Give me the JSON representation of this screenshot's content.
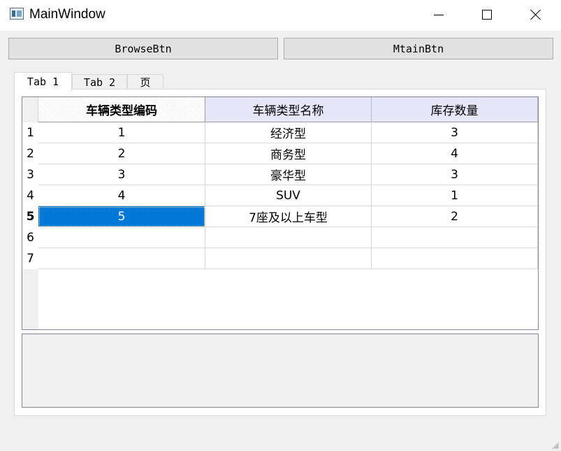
{
  "window": {
    "title": "MainWindow",
    "icon": "app-window-icon",
    "controls": [
      "minimize-icon",
      "maximize-icon",
      "close-icon"
    ]
  },
  "toolbar": {
    "browse_label": "BrowseBtn",
    "mtain_label": "MtainBtn"
  },
  "tabs": [
    {
      "label": "Tab 1",
      "active": true
    },
    {
      "label": "Tab 2",
      "active": false
    },
    {
      "label": "页",
      "active": false
    }
  ],
  "table": {
    "columns": [
      "车辆类型编码",
      "车辆类型名称",
      "库存数量"
    ],
    "row_headers": [
      "1",
      "2",
      "3",
      "4",
      "5",
      "6",
      "7"
    ],
    "rows": [
      [
        "1",
        "经济型",
        "3"
      ],
      [
        "2",
        "商务型",
        "4"
      ],
      [
        "3",
        "豪华型",
        "3"
      ],
      [
        "4",
        "SUV",
        "1"
      ],
      [
        "5",
        "7座及以上车型",
        "2"
      ],
      [
        "",
        "",
        ""
      ],
      [
        "",
        "",
        ""
      ]
    ],
    "selected_row": 5,
    "selected_column": 1,
    "selection_color": "#0078d7",
    "header_color": "#e6e6fa"
  }
}
